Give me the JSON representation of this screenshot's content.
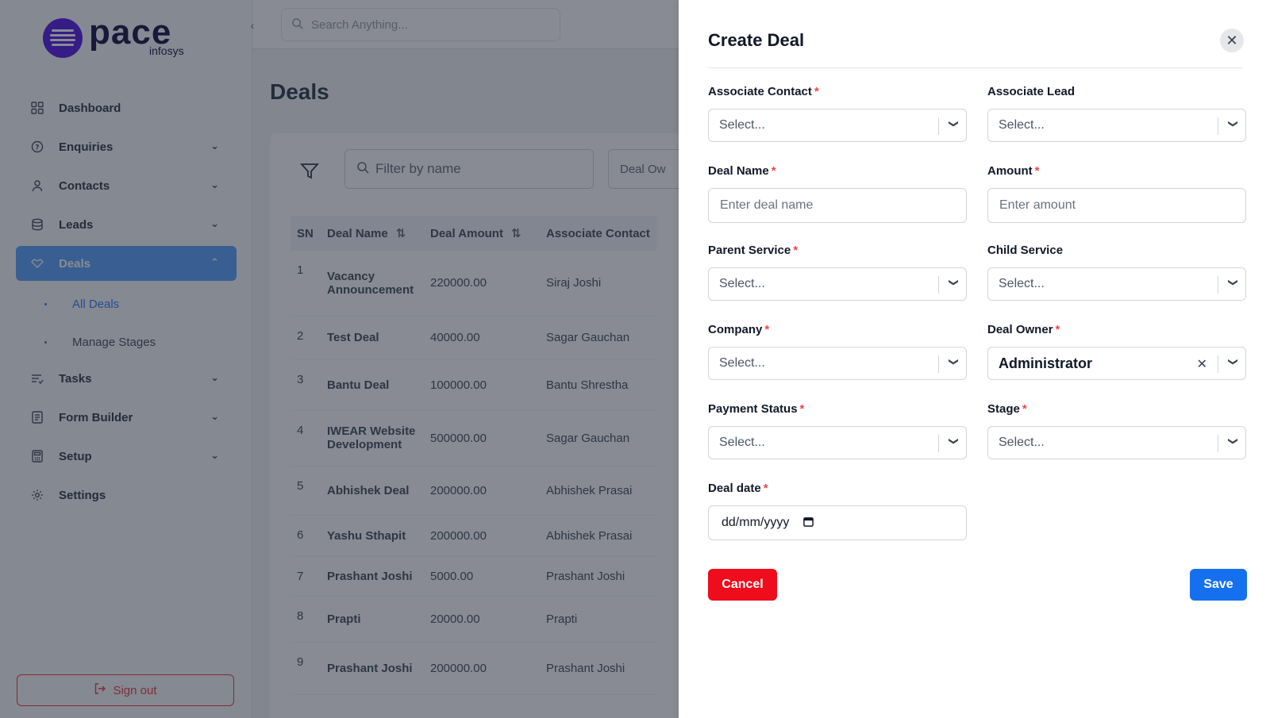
{
  "sidebar": {
    "logo_name": "pace",
    "logo_sub": "infosys",
    "items": [
      {
        "label": "Dashboard"
      },
      {
        "label": "Enquiries"
      },
      {
        "label": "Contacts"
      },
      {
        "label": "Leads"
      },
      {
        "label": "Deals"
      },
      {
        "label": "Tasks"
      },
      {
        "label": "Form Builder"
      },
      {
        "label": "Setup"
      },
      {
        "label": "Settings"
      }
    ],
    "deals_sub": [
      {
        "label": "All Deals"
      },
      {
        "label": "Manage Stages"
      }
    ],
    "signout": "Sign out"
  },
  "topbar": {
    "search_placeholder": "Search Anything..."
  },
  "main": {
    "title": "Deals",
    "filter_placeholder": "Filter by name",
    "owner_chip": "Deal Ow",
    "columns": [
      "SN",
      "Deal Name",
      "Deal Amount",
      "Associate Contact"
    ],
    "rows": [
      {
        "sn": "1",
        "name": "Vacancy Announcement",
        "amount": "220000.00",
        "contact": "Siraj Joshi"
      },
      {
        "sn": "2",
        "name": "Test Deal",
        "amount": "40000.00",
        "contact": "Sagar Gauchan"
      },
      {
        "sn": "3",
        "name": "Bantu Deal",
        "amount": "100000.00",
        "contact": "Bantu Shrestha"
      },
      {
        "sn": "4",
        "name": "IWEAR Website Development",
        "amount": "500000.00",
        "contact": "Sagar Gauchan"
      },
      {
        "sn": "5",
        "name": "Abhishek Deal",
        "amount": "200000.00",
        "contact": "Abhishek Prasai"
      },
      {
        "sn": "6",
        "name": "Yashu Sthapit",
        "amount": "200000.00",
        "contact": "Abhishek Prasai"
      },
      {
        "sn": "7",
        "name": "Prashant Joshi",
        "amount": "5000.00",
        "contact": "Prashant Joshi"
      },
      {
        "sn": "8",
        "name": "Prapti",
        "amount": "20000.00",
        "contact": "Prapti"
      },
      {
        "sn": "9",
        "name": "Prashant Joshi",
        "amount": "200000.00",
        "contact": "Prashant Joshi"
      }
    ]
  },
  "drawer": {
    "title": "Create Deal",
    "fields": {
      "associate_contact": {
        "label": "Associate Contact",
        "placeholder": "Select..."
      },
      "associate_lead": {
        "label": "Associate Lead",
        "placeholder": "Select..."
      },
      "deal_name": {
        "label": "Deal Name",
        "placeholder": "Enter deal name"
      },
      "amount": {
        "label": "Amount",
        "placeholder": "Enter amount"
      },
      "parent_service": {
        "label": "Parent Service",
        "placeholder": "Select..."
      },
      "child_service": {
        "label": "Child Service",
        "placeholder": "Select..."
      },
      "company": {
        "label": "Company",
        "placeholder": "Select..."
      },
      "deal_owner": {
        "label": "Deal Owner",
        "value": "Administrator"
      },
      "payment_status": {
        "label": "Payment Status",
        "placeholder": "Select..."
      },
      "stage": {
        "label": "Stage",
        "placeholder": "Select..."
      },
      "deal_date": {
        "label": "Deal date",
        "placeholder": "dd/mm/yyyy"
      }
    },
    "cancel_label": "Cancel",
    "save_label": "Save"
  },
  "colors": {
    "brand": "#5b21e6",
    "active_nav": "#60a5fa",
    "cancel": "#ef0c1c",
    "save": "#1570ef",
    "required": "#ef4444"
  }
}
